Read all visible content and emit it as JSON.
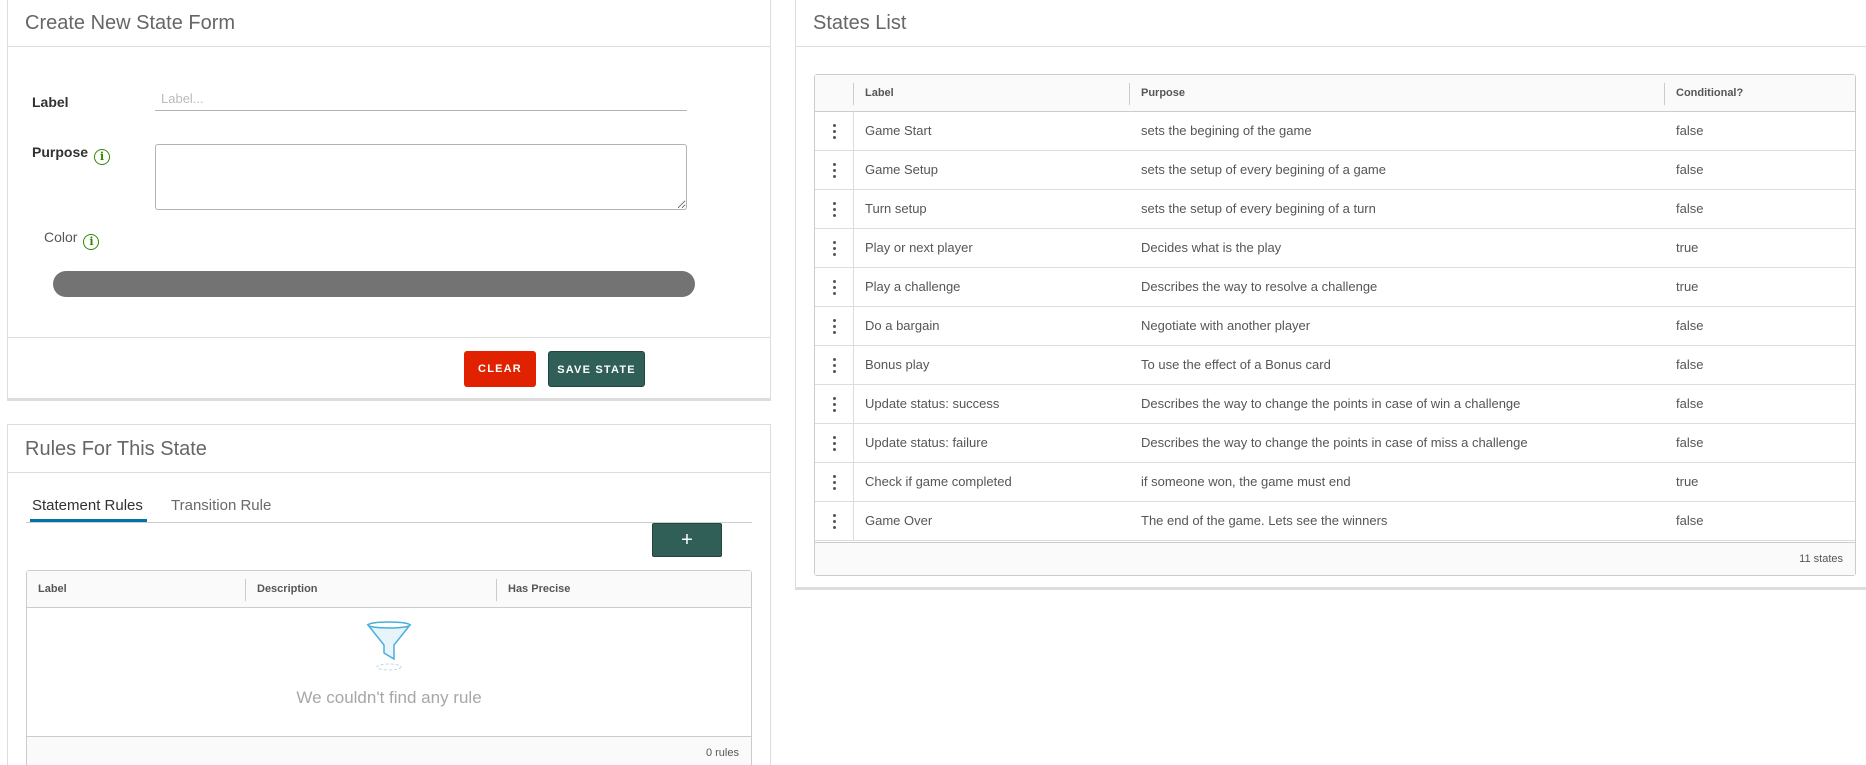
{
  "form": {
    "title": "Create New State Form",
    "label_label": "Label",
    "label_placeholder": "Label...",
    "purpose_label": "Purpose",
    "color_label": "Color",
    "info_glyph": "i",
    "color_value": "#737373",
    "clear_label": "CLEAR",
    "save_label": "SAVE STATE"
  },
  "rules": {
    "title": "Rules For This State",
    "tabs": [
      "Statement Rules",
      "Transition Rule"
    ],
    "add_label": "+",
    "columns": [
      "Label",
      "Description",
      "Has Precise"
    ],
    "empty_text": "We couldn't find any rule",
    "footer": "0 rules"
  },
  "states": {
    "title": "States List",
    "columns": [
      "Label",
      "Purpose",
      "Conditional?"
    ],
    "rows": [
      {
        "label": "Game Start",
        "purpose": "sets the begining of the game",
        "conditional": "false"
      },
      {
        "label": "Game Setup",
        "purpose": "sets the setup of every begining of a game",
        "conditional": "false"
      },
      {
        "label": "Turn setup",
        "purpose": "sets the setup of every begining of a turn",
        "conditional": "false"
      },
      {
        "label": "Play or next player",
        "purpose": "Decides what is the play",
        "conditional": "true"
      },
      {
        "label": "Play a challenge",
        "purpose": "Describes the way to resolve a challenge",
        "conditional": "true"
      },
      {
        "label": "Do a bargain",
        "purpose": "Negotiate with another player",
        "conditional": "false"
      },
      {
        "label": "Bonus play",
        "purpose": "To use the effect of a Bonus card",
        "conditional": "false"
      },
      {
        "label": "Update status: success",
        "purpose": "Describes the way to change the points in case of win a challenge",
        "conditional": "false"
      },
      {
        "label": "Update status: failure",
        "purpose": "Describes the way to change the points in case of miss a challenge",
        "conditional": "false"
      },
      {
        "label": "Check if game completed",
        "purpose": "if someone won, the game must end",
        "conditional": "true"
      },
      {
        "label": "Game Over",
        "purpose": "The end of the game. Lets see the winners",
        "conditional": "false"
      }
    ],
    "footer": "11 states"
  },
  "colors": {
    "accent": "#2f5f57",
    "danger": "#e02200",
    "info": "#318700",
    "tab_active": "#0072a3"
  }
}
